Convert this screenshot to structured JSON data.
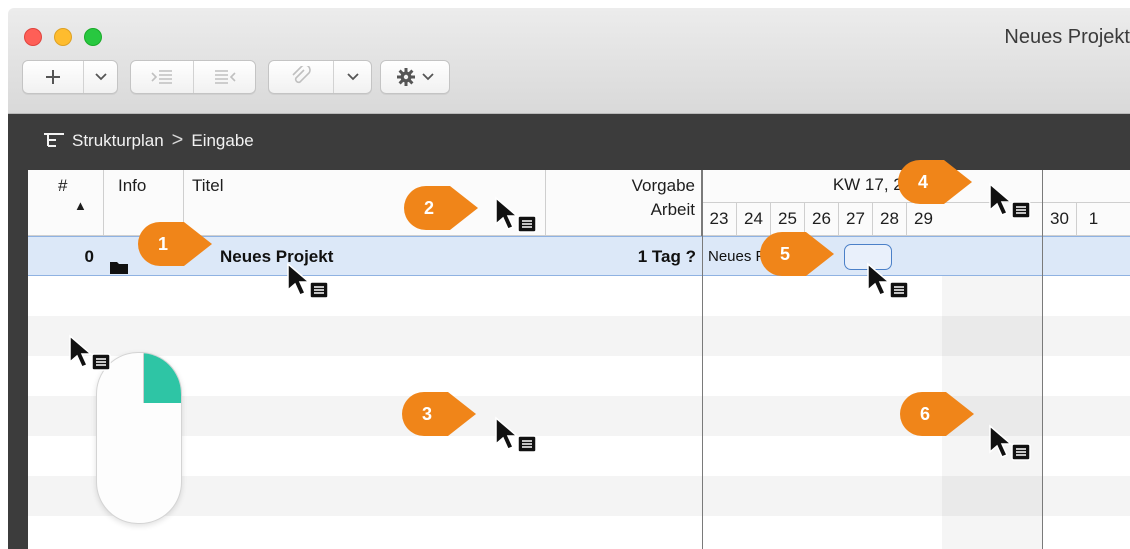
{
  "window": {
    "title": "Neues Projekt",
    "traffic_lights": [
      "close",
      "minimize",
      "zoom"
    ]
  },
  "toolbar": {
    "add_icon": "plus-icon",
    "add_menu_icon": "chevron-down-icon",
    "indent_icon": "indent-icon",
    "outdent_icon": "outdent-icon",
    "link_icon": "paperclip-link-icon",
    "link_menu_icon": "chevron-down-icon",
    "action_icon": "gear-icon"
  },
  "breadcrumb": {
    "icon": "structure-plan-icon",
    "root": "Strukturplan",
    "separator": ">",
    "current": "Eingabe"
  },
  "table": {
    "columns": {
      "number": "#",
      "sort_indicator": "▲",
      "info": "Info",
      "title": "Titel",
      "work_line1": "Vorgabe",
      "work_line2": "Arbeit"
    },
    "gantt": {
      "week_label": "KW 17, 23",
      "days": [
        "23",
        "24",
        "25",
        "26",
        "27",
        "28",
        "29",
        "30",
        "1"
      ]
    },
    "rows": [
      {
        "number": "0",
        "info_icon": "folder-icon",
        "title": "Neues Projekt",
        "work": "1 Tag ?",
        "bar_label": "Neues Projekt"
      }
    ]
  },
  "callouts": [
    "1",
    "2",
    "3",
    "4",
    "5",
    "6"
  ],
  "colors": {
    "callout": "#f08519",
    "selection": "#dce8f8",
    "mouse_right_button": "#2ec5a5",
    "dark_bar": "#3c3c3c"
  },
  "illustration": {
    "mouse": "right-click-mouse-icon",
    "cursor": "context-menu-cursor-icon"
  }
}
